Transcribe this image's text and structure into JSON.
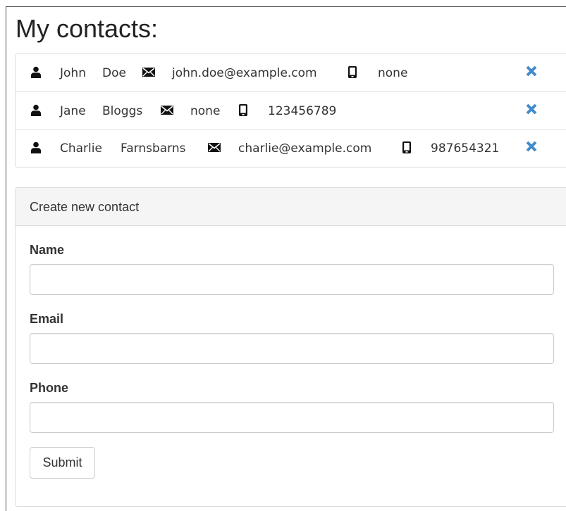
{
  "page": {
    "title": "My contacts:"
  },
  "contacts": [
    {
      "first_name": "John",
      "last_name": "Doe",
      "email": "john.doe@example.com",
      "phone": "none"
    },
    {
      "first_name": "Jane",
      "last_name": "Bloggs",
      "email": "none",
      "phone": "123456789"
    },
    {
      "first_name": "Charlie",
      "last_name": "Farnsbarns",
      "email": "charlie@example.com",
      "phone": "987654321"
    }
  ],
  "icons": {
    "person": "user-icon",
    "email": "envelope-icon",
    "phone": "mobile-phone-icon",
    "delete": "remove-icon"
  },
  "form": {
    "heading": "Create new contact",
    "name_label": "Name",
    "name_value": "",
    "email_label": "Email",
    "email_value": "",
    "phone_label": "Phone",
    "phone_value": "",
    "submit_label": "Submit"
  },
  "colors": {
    "delete_icon": "#428bca",
    "text": "#333333",
    "panel_heading_bg": "#f5f5f5",
    "border": "#dddddd"
  }
}
